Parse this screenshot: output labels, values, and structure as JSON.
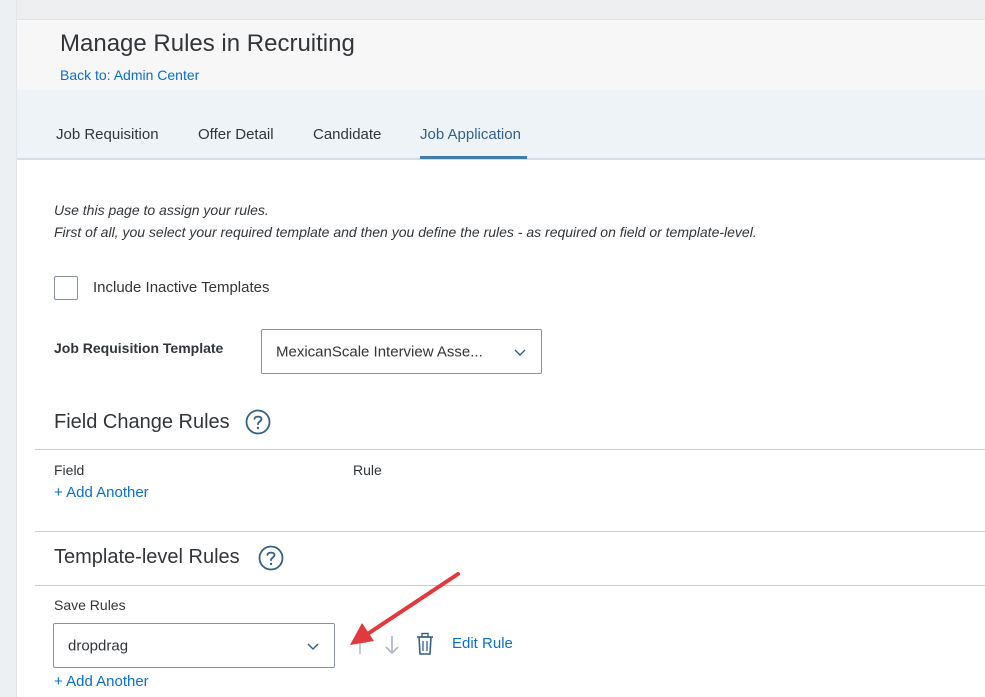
{
  "page": {
    "title": "Manage Rules in Recruiting",
    "back_link": "Back to: Admin Center"
  },
  "tabs": [
    {
      "label": "Job Requisition",
      "selected": false
    },
    {
      "label": "Offer Detail",
      "selected": false
    },
    {
      "label": "Candidate",
      "selected": false
    },
    {
      "label": "Job Application",
      "selected": true
    }
  ],
  "intro": {
    "line1": "Use this page to assign your rules.",
    "line2": "First of all, you select your required template and then you define the rules - as required on field or template-level."
  },
  "inactive_templates": {
    "label": "Include Inactive Templates",
    "checked": false
  },
  "template": {
    "label": "Job Requisition Template",
    "value": "MexicanScale Interview Asse..."
  },
  "field_change_rules": {
    "title": "Field Change Rules",
    "col_field": "Field",
    "col_rule": "Rule",
    "add_link": "+ Add Another"
  },
  "template_rules": {
    "title": "Template-level Rules",
    "save_label": "Save Rules",
    "save_value": "dropdrag",
    "edit_rule": "Edit Rule",
    "add_link": "+ Add Another"
  },
  "icons": {
    "help": "question-circle-icon",
    "move_up": "arrow-up-icon",
    "move_down": "arrow-down-icon",
    "delete": "trash-icon",
    "dropdown": "chevron-down-icon"
  },
  "colors": {
    "link": "#0a6ed1",
    "tab_selected": "#346187",
    "annotation_arrow": "#e0393e"
  }
}
